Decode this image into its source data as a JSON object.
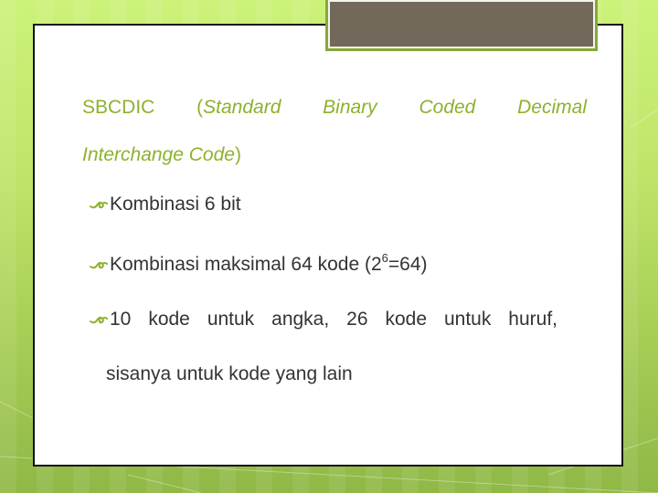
{
  "colors": {
    "accent_green": "#8cb22d",
    "body_text": "#333333",
    "title_tab": "#72695a",
    "card_border": "#111111"
  },
  "heading": {
    "words_row1": [
      "SBCDIC",
      "(Standard",
      "Binary",
      "Coded",
      "Decimal"
    ],
    "row2_italic": "Interchange Code",
    "row2_close": ")",
    "open_paren": "(",
    "standard": "Standard"
  },
  "bullets": [
    {
      "icon": "curl-bullet-icon",
      "text": "Kombinasi 6 bit"
    },
    {
      "icon": "curl-bullet-icon",
      "text_before": "Kombinasi maksimal 64 kode (2",
      "superscript": "6",
      "text_after": "=64)"
    },
    {
      "icon": "curl-bullet-icon",
      "words": [
        "10",
        "kode",
        "untuk",
        "angka,",
        "26",
        "kode",
        "untuk",
        "huruf,"
      ],
      "continuation": "sisanya untuk kode yang lain"
    }
  ]
}
